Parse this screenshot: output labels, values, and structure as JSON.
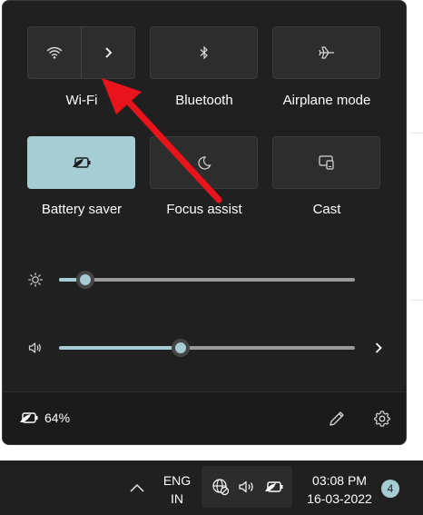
{
  "quick_settings": {
    "tiles": [
      {
        "label": "Wi-Fi",
        "icon": "wifi-icon",
        "active": false,
        "has_expand": true
      },
      {
        "label": "Bluetooth",
        "icon": "bluetooth-icon",
        "active": false
      },
      {
        "label": "Airplane mode",
        "icon": "airplane-icon",
        "active": false
      },
      {
        "label": "Battery saver",
        "icon": "battery-saver-icon",
        "active": true
      },
      {
        "label": "Focus assist",
        "icon": "moon-icon",
        "active": false
      },
      {
        "label": "Cast",
        "icon": "cast-icon",
        "active": false
      }
    ],
    "brightness": {
      "icon": "sun-icon",
      "level_percent": 9
    },
    "volume": {
      "icon": "speaker-icon",
      "level_percent": 41,
      "has_more": true
    },
    "footer": {
      "battery_percent": "64%",
      "battery_icon": "battery-saver-icon",
      "edit_icon": "pencil-icon",
      "settings_icon": "gear-icon"
    }
  },
  "taskbar": {
    "chevron_icon": "chevron-up-icon",
    "language_line1": "ENG",
    "language_line2": "IN",
    "system_icons": [
      "globe-blocked-icon",
      "speaker-icon",
      "battery-saver-icon"
    ],
    "time": "03:08 PM",
    "date": "16-03-2022",
    "notification_count": "4"
  },
  "colors": {
    "accent": "#a5cdd3",
    "panel_bg": "#202020",
    "tile_bg": "#2d2d2d",
    "annotation_arrow": "#e8141b"
  }
}
